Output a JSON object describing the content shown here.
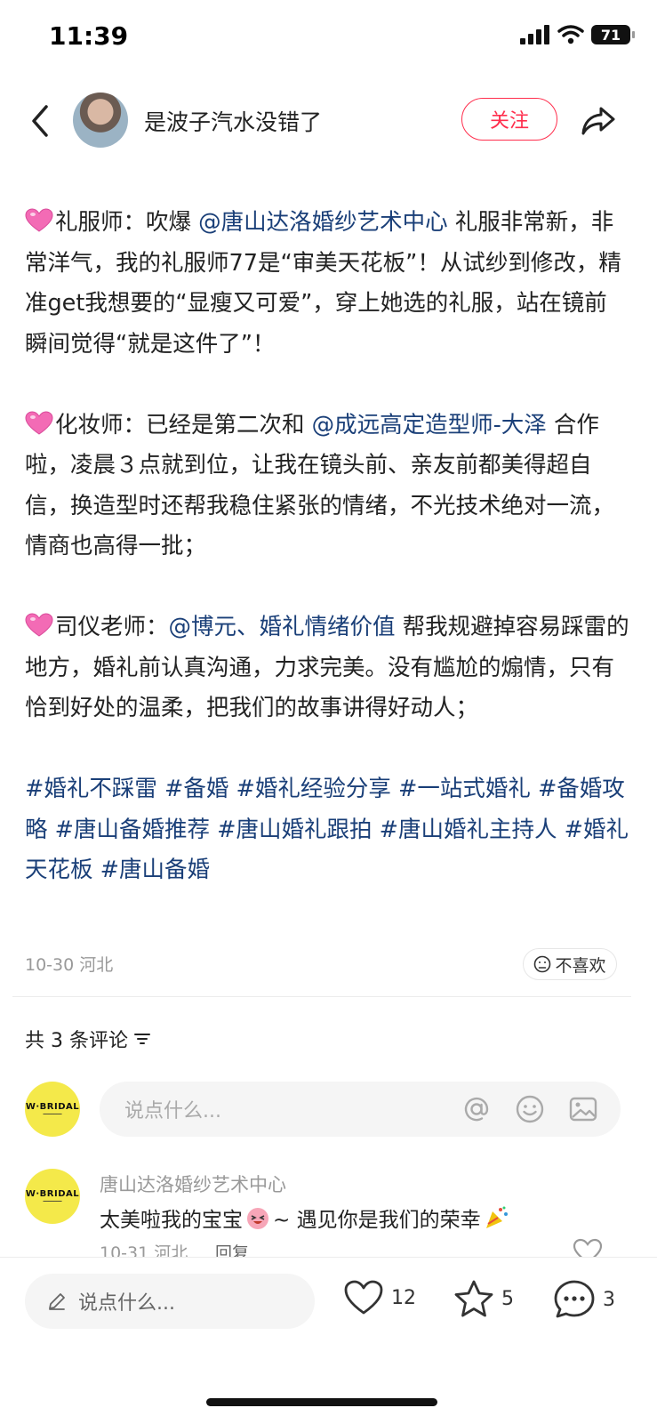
{
  "status_bar": {
    "time": "11:39",
    "battery": "71"
  },
  "header": {
    "author_name": "是波子汽水没错了",
    "follow_label": "关注"
  },
  "post": {
    "paragraphs": [
      [
        {
          "t": "heart"
        },
        {
          "t": "text",
          "v": "礼服师：吹爆 "
        },
        {
          "t": "mention",
          "v": "@唐山达洛婚纱艺术中心"
        },
        {
          "t": "text",
          "v": " 礼服非常新，非常洋气，我的礼服师77是“审美天花板”！从试纱到修改，精准get我想要的“显瘦又可爱”，穿上她选的礼服，站在镜前瞬间觉得“就是这件了”！"
        }
      ],
      [
        {
          "t": "heart"
        },
        {
          "t": "text",
          "v": "化妆师：已经是第二次和 "
        },
        {
          "t": "mention",
          "v": "@成远高定造型师-大泽"
        },
        {
          "t": "text",
          "v": " 合作啦，凌晨３点就到位，让我在镜头前、亲友前都美得超自信，换造型时还帮我稳住紧张的情绪，不光技术绝对一流，情商也高得一批；"
        }
      ],
      [
        {
          "t": "heart"
        },
        {
          "t": "text",
          "v": "司仪老师："
        },
        {
          "t": "mention",
          "v": "@博元、婚礼情绪价值"
        },
        {
          "t": "text",
          "v": " 帮我规避掉容易踩雷的地方，婚礼前认真沟通，力求完美。没有尴尬的煽情，只有恰到好处的温柔，把我们的故事讲得好动人；"
        }
      ]
    ],
    "tags": [
      "#婚礼不踩雷",
      "#备婚",
      "#婚礼经验分享",
      "#一站式婚礼",
      "#备婚攻略",
      "#唐山备婚推荐",
      "#唐山婚礼跟拍",
      "#唐山婚礼主持人",
      "#婚礼天花板",
      "#唐山备婚"
    ],
    "date_location": "10-30 河北",
    "dislike_label": "不喜欢"
  },
  "comments": {
    "count_label": "共 3 条评论",
    "input_placeholder": "说点什么...",
    "brand_avatar_text": "W·BRIDAL",
    "items": [
      {
        "author": "唐山达洛婚纱艺术中心",
        "text_a": "太美啦我的宝宝",
        "text_b": "~ 遇见你是我们的荣幸",
        "meta": "10-31 河北",
        "reply_label": "回复"
      }
    ]
  },
  "bottom_bar": {
    "placeholder": "说点什么...",
    "likes": "12",
    "stars": "5",
    "comments": "3"
  },
  "colors": {
    "accent": "#ff2e4d",
    "link": "#1a3f78",
    "brand_yellow": "#f4e94a"
  }
}
